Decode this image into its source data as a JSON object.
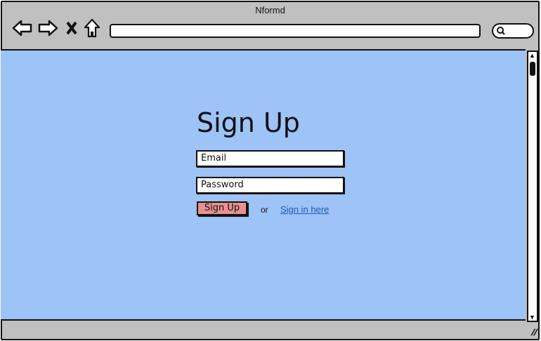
{
  "window": {
    "title": "Nformd"
  },
  "toolbar": {
    "url": "",
    "search": ""
  },
  "form": {
    "heading": "Sign Up",
    "email_value": "Email",
    "password_value": "Password",
    "submit_label": "Sign Up",
    "or_text": "or",
    "signin_link": "Sign in here"
  },
  "colors": {
    "content_bg": "#9dc3f7",
    "button": "#e99090",
    "link": "#2456b8"
  }
}
